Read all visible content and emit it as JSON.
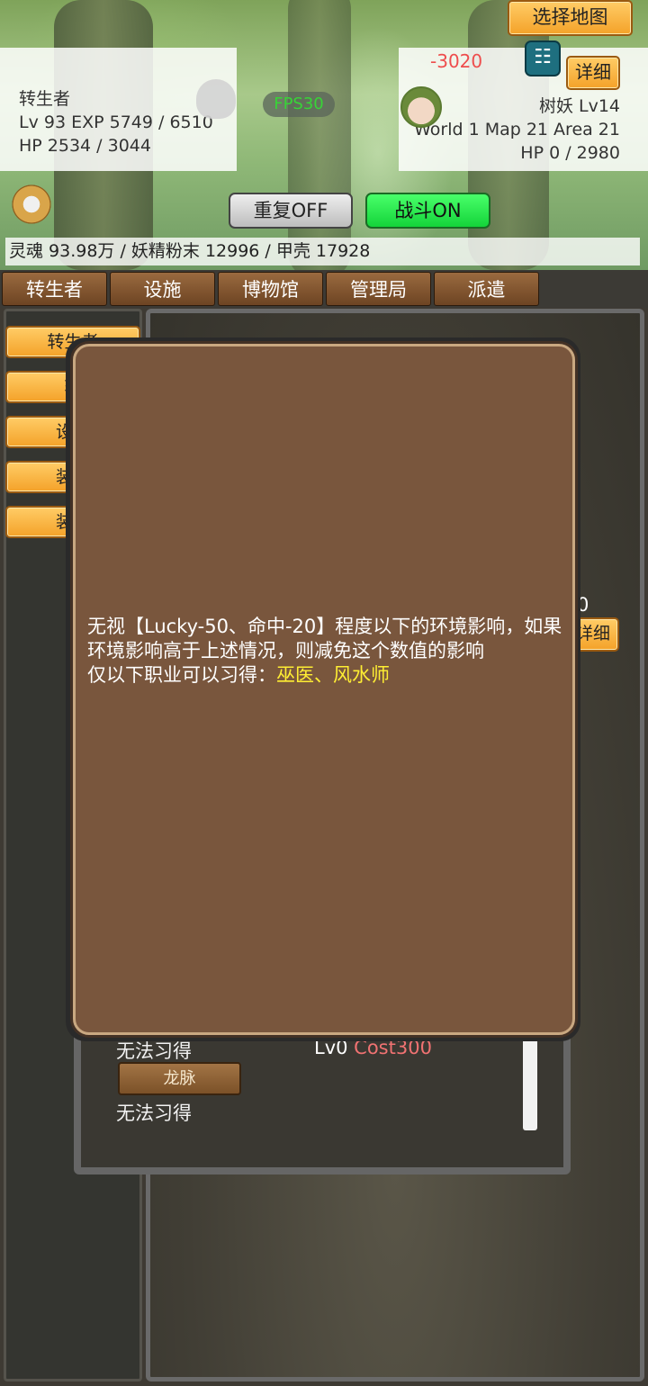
{
  "hero": {
    "name": "转生者",
    "level_exp": "Lv 93 EXP 5749 / 6510",
    "hp": "HP 2534 / 3044"
  },
  "fps": "FPS30",
  "enemy": {
    "damage": "-3020",
    "detail_label": "详细",
    "name": "树妖 Lv14",
    "location": "World 1 Map 21 Area 21",
    "hp": "HP 0 / 2980"
  },
  "controls": {
    "repeat": "重复OFF",
    "battle": "战斗ON",
    "select_map": "选择地图"
  },
  "resources": "灵魂 93.98万 / 妖精粉末 12996 / 甲壳 17928",
  "tabs": [
    "转生者",
    "设施",
    "博物馆",
    "管理局",
    "派遣"
  ],
  "sidebar": [
    "转生者",
    "转",
    "设置",
    "装备",
    "装备"
  ],
  "background_partial": {
    "value": "0",
    "detail_label": "详细"
  },
  "skills": {
    "row1_status": "无法习得",
    "row1_level": "Lv0 ",
    "row1_cost": "Cost300",
    "chip": "龙脉",
    "row2_status": "无法习得"
  },
  "popup": {
    "description": "无视【Lucky-50、命中-20】程度以下的环境影响，如果环境影响高于上述情况，则减免这个数值的影响",
    "classes_prefix": "仅以下职业可以习得：",
    "classes": "巫医、风水师"
  },
  "colors": {
    "battle_on": "#14d43a",
    "damage": "#ee4d4d",
    "cost": "#f07272",
    "highlight": "#ffee33",
    "popup_bg": "#79563d"
  }
}
